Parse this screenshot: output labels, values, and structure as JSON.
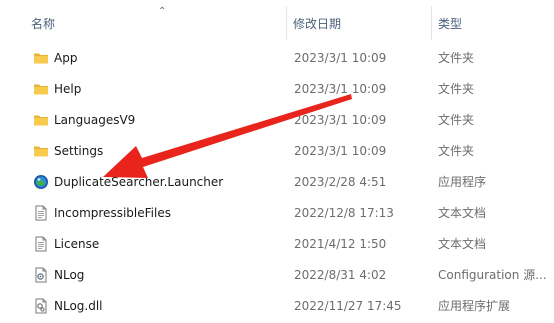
{
  "columns": {
    "name": "名称",
    "date_modified": "修改日期",
    "type": "类型"
  },
  "files": [
    {
      "name": "App",
      "date": "2023/3/1 10:09",
      "type": "文件夹",
      "icon": "folder-icon"
    },
    {
      "name": "Help",
      "date": "2023/3/1 10:09",
      "type": "文件夹",
      "icon": "folder-icon"
    },
    {
      "name": "LanguagesV9",
      "date": "2023/3/1 10:09",
      "type": "文件夹",
      "icon": "folder-icon"
    },
    {
      "name": "Settings",
      "date": "2023/3/1 10:09",
      "type": "文件夹",
      "icon": "folder-icon"
    },
    {
      "name": "DuplicateSearcher.Launcher",
      "date": "2023/2/28 4:51",
      "type": "应用程序",
      "icon": "app-icon"
    },
    {
      "name": "IncompressibleFiles",
      "date": "2022/12/8 17:13",
      "type": "文本文档",
      "icon": "text-file-icon"
    },
    {
      "name": "License",
      "date": "2021/4/12 1:50",
      "type": "文本文档",
      "icon": "text-file-icon"
    },
    {
      "name": "NLog",
      "date": "2022/8/31 4:02",
      "type": "Configuration 源...",
      "icon": "config-file-icon"
    },
    {
      "name": "NLog.dll",
      "date": "2022/11/27 17:45",
      "type": "应用程序扩展",
      "icon": "dll-file-icon"
    }
  ],
  "colors": {
    "annotation_arrow": "#e8241c",
    "folder": "#f5c342",
    "header_text": "#4c607a"
  }
}
